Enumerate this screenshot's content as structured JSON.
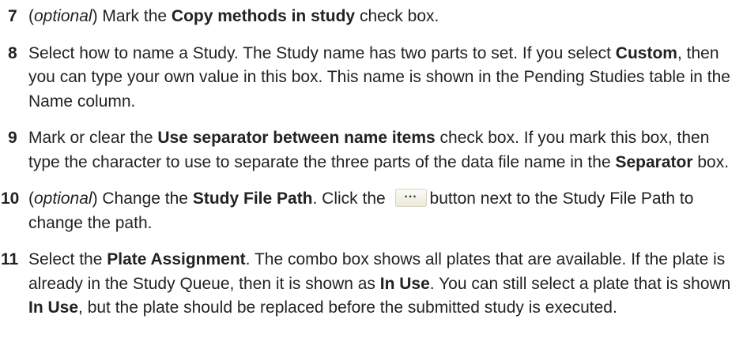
{
  "steps": [
    {
      "number": "7",
      "parts": [
        "(",
        "optional",
        ") Mark the ",
        "Copy methods in study",
        " check box."
      ]
    },
    {
      "number": "8",
      "parts": [
        "Select how to name a Study. The Study name has two parts to set. If you select ",
        "Custom",
        ", then you can type your own value in this box. This name is shown in the Pending Studies table in the Name column."
      ]
    },
    {
      "number": "9",
      "parts": [
        "Mark or clear the ",
        "Use separator between name items",
        " check box. If you mark this box, then type the character to use to separate the three parts of the data file name in the ",
        "Separator",
        " box."
      ]
    },
    {
      "number": "10",
      "parts": [
        "(",
        "optional",
        ") Change the ",
        "Study File Path",
        ". Click the ",
        "button next to the Study File Path to change the path."
      ],
      "inline_button_label": "..."
    },
    {
      "number": "11",
      "parts": [
        "Select the ",
        "Plate Assignment",
        ". The combo box shows all plates that are available. If the plate is already in the Study Queue, then it is shown as ",
        "In Use",
        ". You can still select a plate that is shown ",
        "In Use",
        ", but the plate should be replaced before the submitted study is executed."
      ]
    }
  ]
}
